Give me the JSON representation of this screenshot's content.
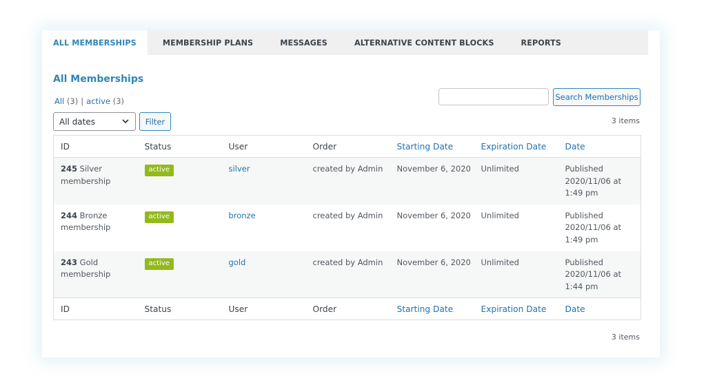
{
  "tabs": [
    {
      "label": "ALL MEMBERSHIPS",
      "active": true
    },
    {
      "label": "MEMBERSHIP PLANS",
      "active": false
    },
    {
      "label": "MESSAGES",
      "active": false
    },
    {
      "label": "ALTERNATIVE CONTENT BLOCKS",
      "active": false
    },
    {
      "label": "REPORTS",
      "active": false
    }
  ],
  "page_title": "All Memberships",
  "views": {
    "all_label": "All",
    "all_count": "(3)",
    "separator": "|",
    "active_label": "active",
    "active_count": "(3)"
  },
  "search": {
    "value": "",
    "placeholder": "",
    "button_label": "Search Memberships"
  },
  "filters": {
    "date_select_value": "All dates",
    "filter_button_label": "Filter"
  },
  "items_count_top": "3 items",
  "items_count_bottom": "3 items",
  "table": {
    "columns": [
      {
        "label": "ID",
        "sortable": false
      },
      {
        "label": "Status",
        "sortable": false
      },
      {
        "label": "User",
        "sortable": false
      },
      {
        "label": "Order",
        "sortable": false
      },
      {
        "label": "Starting Date",
        "sortable": true
      },
      {
        "label": "Expiration Date",
        "sortable": true
      },
      {
        "label": "Date",
        "sortable": true
      }
    ],
    "rows": [
      {
        "id": "245",
        "name": "Silver membership",
        "status": "active",
        "user": "silver",
        "order": "created by Admin",
        "start": "November 6, 2020",
        "expiration": "Unlimited",
        "date_status": "Published",
        "date": "2020/11/06 at 1:49 pm"
      },
      {
        "id": "244",
        "name": "Bronze membership",
        "status": "active",
        "user": "bronze",
        "order": "created by Admin",
        "start": "November 6, 2020",
        "expiration": "Unlimited",
        "date_status": "Published",
        "date": "2020/11/06 at 1:49 pm"
      },
      {
        "id": "243",
        "name": "Gold membership",
        "status": "active",
        "user": "gold",
        "order": "created by Admin",
        "start": "November 6, 2020",
        "expiration": "Unlimited",
        "date_status": "Published",
        "date": "2020/11/06 at 1:44 pm"
      }
    ]
  },
  "colors": {
    "accent": "#2e86b9",
    "link": "#2271b1",
    "active_badge": "#93ba1c",
    "tab_bar": "#f0f0f1"
  }
}
